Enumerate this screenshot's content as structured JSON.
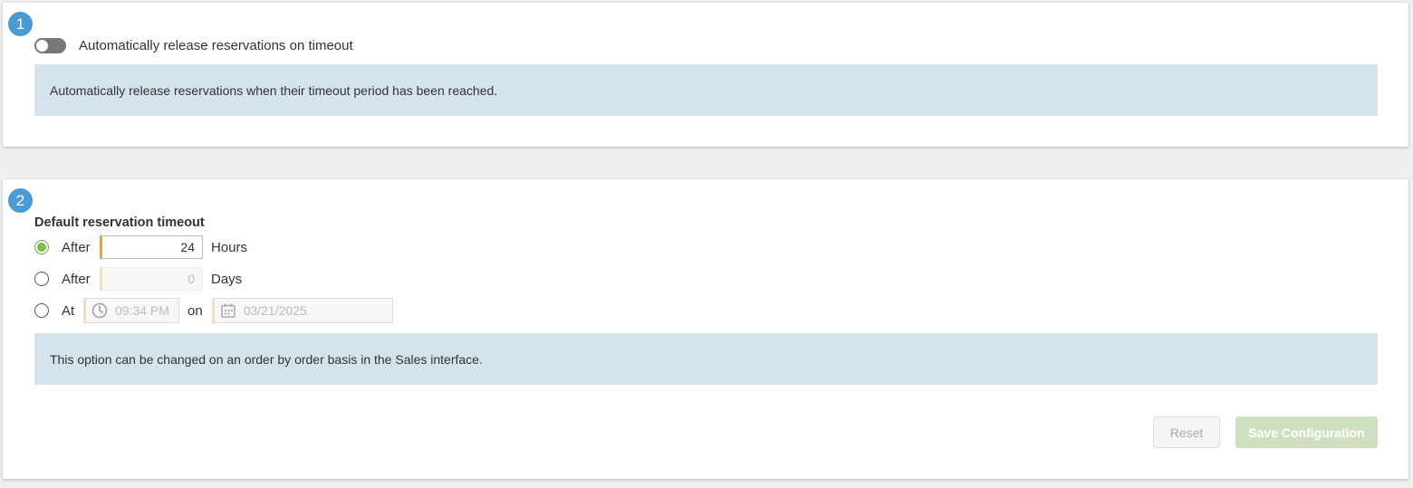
{
  "section1": {
    "step": "1",
    "toggle_label": "Automatically release reservations on timeout",
    "toggle_on": false,
    "info": "Automatically release reservations when their timeout period has been reached."
  },
  "section2": {
    "step": "2",
    "title": "Default reservation timeout",
    "options": {
      "hours": {
        "label": "After",
        "value": "24",
        "unit": "Hours",
        "selected": true
      },
      "days": {
        "label": "After",
        "value": "0",
        "unit": "Days",
        "selected": false
      },
      "at": {
        "label": "At",
        "time": "09:34 PM",
        "on_label": "on",
        "date": "03/21/2025",
        "selected": false
      }
    },
    "info": "This option can be changed on an order by order basis in the Sales interface."
  },
  "buttons": {
    "reset": "Reset",
    "save": "Save Configuration"
  },
  "colors": {
    "step_badge": "#4a9bd5",
    "info_bg": "#d5e3ea",
    "radio_selected": "#7cbf45",
    "input_accent": "#d8a652",
    "save_disabled": "#cfe0c1"
  }
}
